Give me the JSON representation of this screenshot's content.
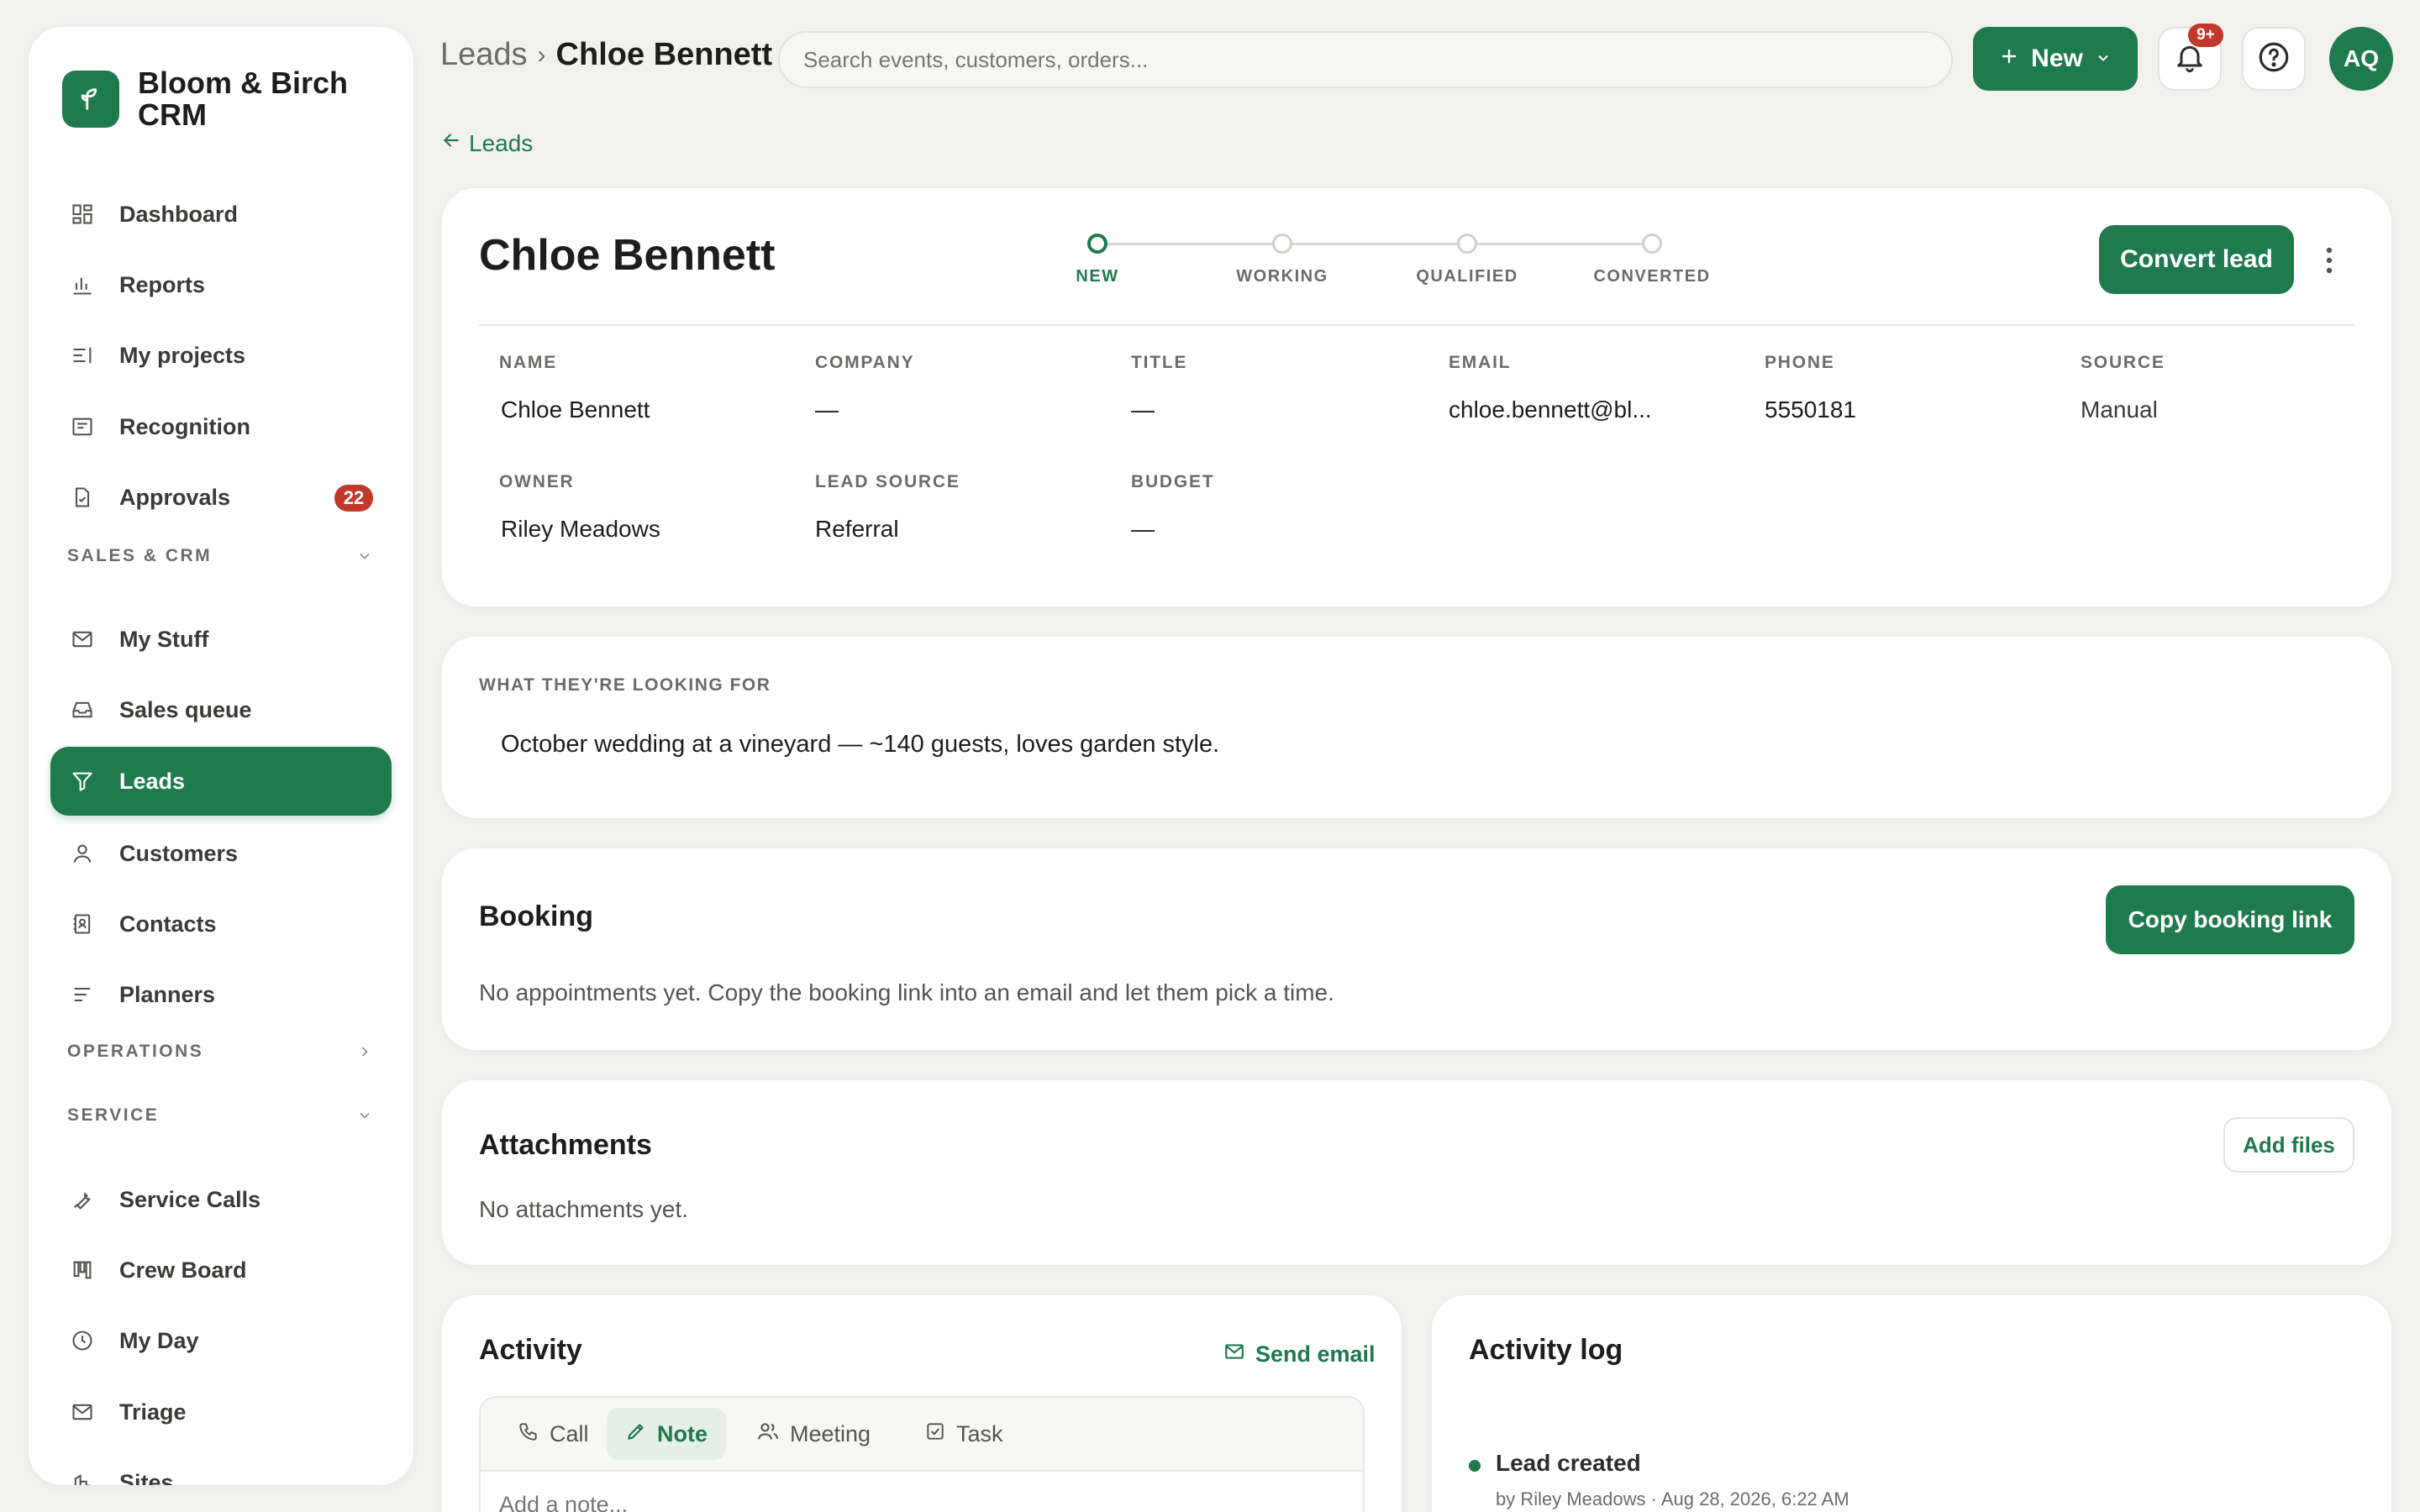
{
  "app": {
    "name": "Bloom & Birch CRM"
  },
  "sidebar": {
    "items": [
      {
        "label": "Dashboard"
      },
      {
        "label": "Reports"
      },
      {
        "label": "My projects"
      },
      {
        "label": "Recognition"
      },
      {
        "label": "Approvals",
        "badge": "22"
      },
      {
        "label": "My Stuff"
      },
      {
        "label": "Sales queue"
      },
      {
        "label": "Leads",
        "active": true
      },
      {
        "label": "Customers"
      },
      {
        "label": "Contacts"
      },
      {
        "label": "Planners"
      },
      {
        "label": "Service Calls"
      },
      {
        "label": "Crew Board"
      },
      {
        "label": "My Day"
      },
      {
        "label": "Triage"
      },
      {
        "label": "Sites"
      }
    ],
    "sections": [
      {
        "label": "SALES & CRM",
        "state": "expanded"
      },
      {
        "label": "OPERATIONS",
        "state": "collapsed"
      },
      {
        "label": "SERVICE",
        "state": "expanded"
      }
    ]
  },
  "header": {
    "breadcrumb_parent": "Leads",
    "breadcrumb_sep": "›",
    "breadcrumb_current": "Chloe Bennett",
    "search_placeholder": "Search events, customers, orders...",
    "new_label": "New",
    "notifications_badge": "9+",
    "avatar_initials": "AQ"
  },
  "back_link": "Leads",
  "lead": {
    "name": "Chloe Bennett",
    "convert_label": "Convert lead",
    "stages": [
      {
        "label": "NEW",
        "current": true
      },
      {
        "label": "WORKING"
      },
      {
        "label": "QUALIFIED"
      },
      {
        "label": "CONVERTED"
      }
    ],
    "fields": [
      {
        "label": "NAME",
        "value": "Chloe Bennett"
      },
      {
        "label": "COMPANY",
        "value": "—"
      },
      {
        "label": "TITLE",
        "value": "—"
      },
      {
        "label": "EMAIL",
        "value": "chloe.bennett@bl..."
      },
      {
        "label": "PHONE",
        "value": "5550181"
      },
      {
        "label": "SOURCE",
        "value": "Manual"
      },
      {
        "label": "OWNER",
        "value": "Riley Meadows"
      },
      {
        "label": "LEAD SOURCE",
        "value": "Referral"
      },
      {
        "label": "BUDGET",
        "value": "—"
      }
    ]
  },
  "looking_for": {
    "heading": "WHAT THEY'RE LOOKING FOR",
    "text": "October wedding at a vineyard — ~140 guests, loves garden style."
  },
  "booking": {
    "title": "Booking",
    "button": "Copy booking link",
    "empty_text": "No appointments yet. Copy the booking link into an email and let them pick a time."
  },
  "attachments": {
    "title": "Attachments",
    "button": "Add files",
    "empty_text": "No attachments yet."
  },
  "activity": {
    "title": "Activity",
    "send_email": "Send email",
    "tabs": [
      {
        "label": "Call"
      },
      {
        "label": "Note",
        "active": true
      },
      {
        "label": "Meeting"
      },
      {
        "label": "Task"
      }
    ],
    "note_placeholder": "Add a note..."
  },
  "activity_log": {
    "title": "Activity log",
    "entries": [
      {
        "title": "Lead created",
        "meta": "by Riley Meadows · Aug 28, 2026, 6:22 AM"
      }
    ]
  },
  "colors": {
    "accent": "#1f7a4d",
    "background": "#f1f1ed",
    "badge": "#c0392b"
  }
}
